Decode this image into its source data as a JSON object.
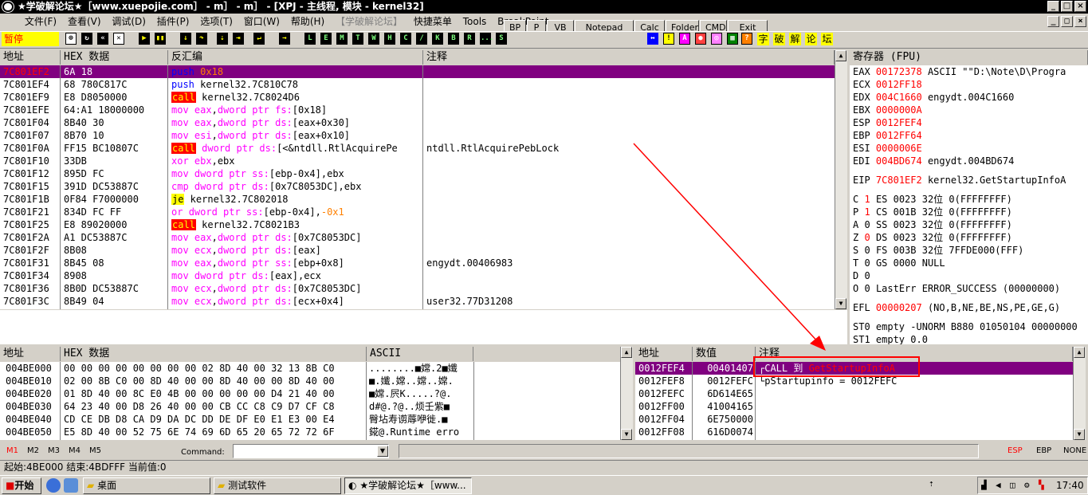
{
  "window": {
    "title": "★学破解论坛★［www.xuepojie.com］ - m］ - m］ - [XPJ - 主线程, 模块 - kernel32]"
  },
  "menu": [
    "文件(F)",
    "查看(V)",
    "调试(D)",
    "插件(P)",
    "选项(T)",
    "窗口(W)",
    "帮助(H)",
    "【学破解论坛】",
    "快捷菜单",
    "Tools",
    "BreakPoint"
  ],
  "quick_buttons": [
    "BP",
    "P",
    "VB",
    "Notepad",
    "Calc",
    "Folder",
    "CMD",
    "Exit"
  ],
  "toolbar": {
    "state": "暂停",
    "letters": [
      "L",
      "E",
      "M",
      "T",
      "W",
      "H",
      "C",
      "/",
      "K",
      "B",
      "R",
      "...",
      "S"
    ],
    "tools_cn": [
      "字",
      "破",
      "解",
      "论",
      "坛"
    ]
  },
  "cpu": {
    "headers": {
      "addr": "地址",
      "hex": "HEX 数据",
      "disasm": "反汇编",
      "comment": "注释"
    },
    "rows": [
      {
        "addr": "7C801EF2",
        "hex": "6A 18",
        "dis": "push 0x18",
        "cmt": ""
      },
      {
        "addr": "7C801EF4",
        "hex": "68 780C817C",
        "dis": "push kernel32.7C810C78",
        "cmt": ""
      },
      {
        "addr": "7C801EF9",
        "hex": "E8 D8050000",
        "dis": "call kernel32.7C8024D6",
        "cmt": ""
      },
      {
        "addr": "7C801EFE",
        "hex": "64:A1 18000000",
        "dis": "mov eax,dword ptr fs:[0x18]",
        "cmt": ""
      },
      {
        "addr": "7C801F04",
        "hex": "8B40 30",
        "dis": "mov eax,dword ptr ds:[eax+0x30]",
        "cmt": ""
      },
      {
        "addr": "7C801F07",
        "hex": "8B70 10",
        "dis": "mov esi,dword ptr ds:[eax+0x10]",
        "cmt": ""
      },
      {
        "addr": "7C801F0A",
        "hex": "FF15 BC10807C",
        "dis": "call dword ptr ds:[<&ntdll.RtlAcquirePe",
        "cmt": "ntdll.RtlAcquirePebLock"
      },
      {
        "addr": "7C801F10",
        "hex": "33DB",
        "dis": "xor ebx,ebx",
        "cmt": ""
      },
      {
        "addr": "7C801F12",
        "hex": "895D FC",
        "dis": "mov dword ptr ss:[ebp-0x4],ebx",
        "cmt": ""
      },
      {
        "addr": "7C801F15",
        "hex": "391D DC53887C",
        "dis": "cmp dword ptr ds:[0x7C8053DC],ebx",
        "cmt": ""
      },
      {
        "addr": "7C801F1B",
        "hex": "0F84 F7000000",
        "dis": "je kernel32.7C802018",
        "cmt": ""
      },
      {
        "addr": "7C801F21",
        "hex": "834D FC FF",
        "dis": "or dword ptr ss:[ebp-0x4],-0x1",
        "cmt": ""
      },
      {
        "addr": "7C801F25",
        "hex": "E8 89020000",
        "dis": "call kernel32.7C8021B3",
        "cmt": ""
      },
      {
        "addr": "7C801F2A",
        "hex": "A1 DC53887C",
        "dis": "mov eax,dword ptr ds:[0x7C8053DC]",
        "cmt": ""
      },
      {
        "addr": "7C801F2F",
        "hex": "8B08",
        "dis": "mov ecx,dword ptr ds:[eax]",
        "cmt": ""
      },
      {
        "addr": "7C801F31",
        "hex": "8B45 08",
        "dis": "mov eax,dword ptr ss:[ebp+0x8]",
        "cmt": "engydt.00406983"
      },
      {
        "addr": "7C801F34",
        "hex": "8908",
        "dis": "mov dword ptr ds:[eax],ecx",
        "cmt": ""
      },
      {
        "addr": "7C801F36",
        "hex": "8B0D DC53887C",
        "dis": "mov ecx,dword ptr ds:[0x7C8053DC]",
        "cmt": ""
      },
      {
        "addr": "7C801F3C",
        "hex": "8B49 04",
        "dis": "mov ecx,dword ptr ds:[ecx+0x4]",
        "cmt": "user32.77D31208"
      }
    ]
  },
  "registers": {
    "header": "寄存器 (FPU)",
    "gp": [
      {
        "name": "EAX",
        "val": "00172378",
        "info": "ASCII \"\"D:\\Note\\D\\Progra"
      },
      {
        "name": "ECX",
        "val": "0012FF18",
        "info": ""
      },
      {
        "name": "EDX",
        "val": "004C1660",
        "info": "engydt.004C1660"
      },
      {
        "name": "EBX",
        "val": "0000000A",
        "info": ""
      },
      {
        "name": "ESP",
        "val": "0012FEF4",
        "info": ""
      },
      {
        "name": "EBP",
        "val": "0012FF64",
        "info": ""
      },
      {
        "name": "ESI",
        "val": "0000006E",
        "info": ""
      },
      {
        "name": "EDI",
        "val": "004BD674",
        "info": "engydt.004BD674"
      }
    ],
    "eip": {
      "name": "EIP",
      "val": "7C801EF2",
      "info": "kernel32.GetStartupInfoA"
    },
    "flags": [
      {
        "f": "C",
        "v": "1",
        "seg": "ES 0023 32位 0(FFFFFFFF)"
      },
      {
        "f": "P",
        "v": "1",
        "seg": "CS 001B 32位 0(FFFFFFFF)"
      },
      {
        "f": "A",
        "v": "0",
        "seg": "SS 0023 32位 0(FFFFFFFF)"
      },
      {
        "f": "Z",
        "v": "0",
        "seg": "DS 0023 32位 0(FFFFFFFF)"
      },
      {
        "f": "S",
        "v": "0",
        "seg": "FS 003B 32位 7FFDE000(FFF)"
      },
      {
        "f": "T",
        "v": "0",
        "seg": "GS 0000 NULL"
      },
      {
        "f": "D",
        "v": "0",
        "seg": ""
      },
      {
        "f": "O",
        "v": "0",
        "seg": "LastErr ERROR_SUCCESS (00000000)"
      }
    ],
    "efl": {
      "name": "EFL",
      "val": "00000207",
      "info": "(NO,B,NE,BE,NS,PE,GE,G)"
    },
    "fpu": [
      "ST0 empty -UNORM B880 01050104 00000000",
      "ST1 empty 0.0"
    ]
  },
  "dump": {
    "headers": {
      "addr": "地址",
      "hex": "HEX 数据",
      "ascii": "ASCII"
    },
    "rows": [
      {
        "addr": "004BE000",
        "hex": "00 00 00 00 00 00 00 00 02 8D 40 00 32 13 8B C0",
        "ascii": "........■嫦.2■孅"
      },
      {
        "addr": "004BE010",
        "hex": "02 00 8B C0 00 8D 40 00 00 8D 40 00 00 8D 40 00",
        "ascii": "■.孅.嫦..嫦..嫦."
      },
      {
        "addr": "004BE020",
        "hex": "01 8D 40 00 8C E0 4B 00 00 00 00 00 D4 21 40 00",
        "ascii": "■嫦.屄K.....?@."
      },
      {
        "addr": "004BE030",
        "hex": "64 23 40 00 D8 26 40 00 00 CB CC C8 C9 D7 CF C8",
        "ascii": "d#@.?@..烦壬紫■"
      },
      {
        "addr": "004BE040",
        "hex": "CD CE DB D8 CA D9 DA DC DD DE DF E0 E1 E3 00 E4",
        "ascii": "臀坫寿谫蓐咿徙.■"
      },
      {
        "addr": "004BE050",
        "hex": "E5 8D 40 00 52 75 6E 74 69 6D 65 20 65 72 72 6F",
        "ascii": "錵@.Runtime erro"
      }
    ]
  },
  "stack": {
    "headers": {
      "addr": "地址",
      "val": "数值",
      "cmt": "注释"
    },
    "rows": [
      {
        "addr": "0012FEF4",
        "val": "00401407",
        "cmt": "┌CALL 到 GetStartupInfoA"
      },
      {
        "addr": "0012FEF8",
        "val": "0012FEFC",
        "cmt": "└pStartupinfo = 0012FEFC"
      },
      {
        "addr": "0012FEFC",
        "val": "6D614E65",
        "cmt": ""
      },
      {
        "addr": "0012FF00",
        "val": "41004165",
        "cmt": ""
      },
      {
        "addr": "0012FF04",
        "val": "6E750000",
        "cmt": ""
      },
      {
        "addr": "0012FF08",
        "val": "616D0074",
        "cmt": ""
      }
    ]
  },
  "command": {
    "tabs": [
      "M1",
      "M2",
      "M3",
      "M4",
      "M5"
    ],
    "label": "Command:",
    "value": "",
    "stack_modes": [
      "ESP",
      "EBP",
      "NONE"
    ]
  },
  "status": "起始:4BE000 结束:4BDFFF 当前值:0",
  "taskbar": {
    "start": "开始",
    "items": [
      "桌面",
      "测试软件",
      "★学破解论坛★［www..."
    ],
    "time": "17:40"
  },
  "colors": {
    "highlight": "#800080",
    "call_bg": "#ff0000",
    "call_fg": "#ffff00",
    "mnemonic": "#ff00ff",
    "push": "#0000ff",
    "annotation": "#ff0000"
  }
}
